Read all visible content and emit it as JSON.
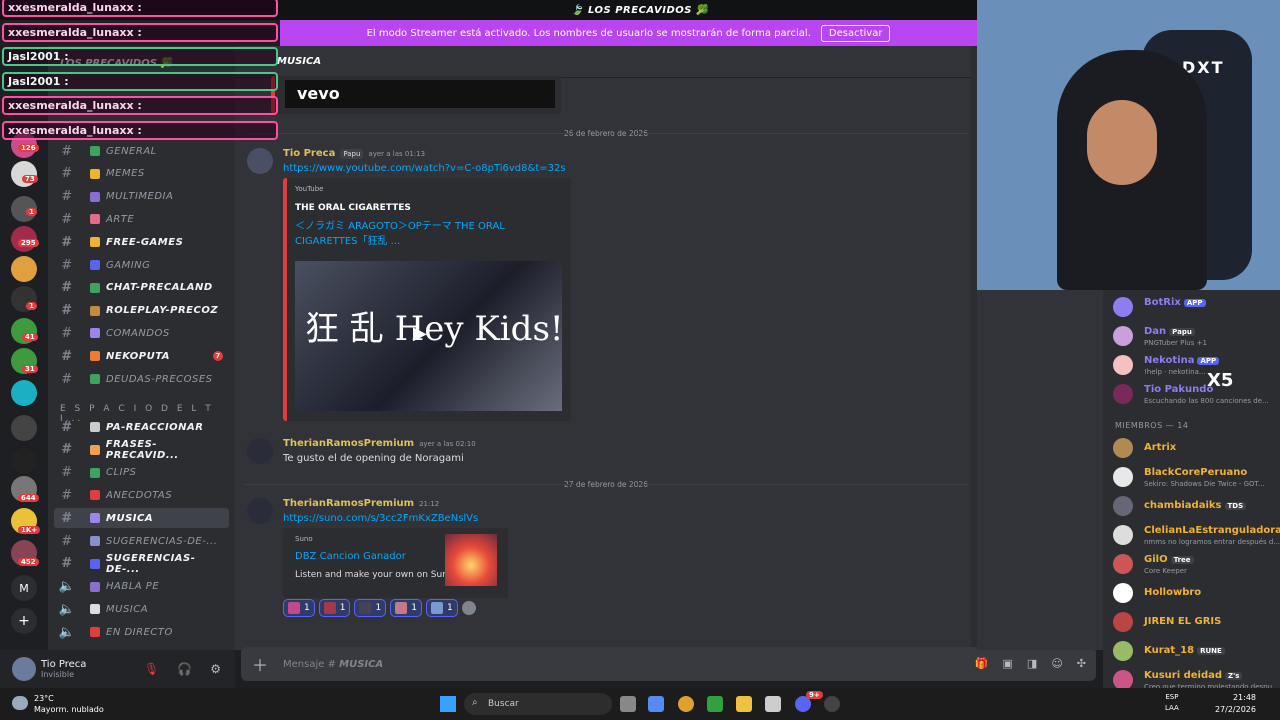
{
  "server": {
    "title": "🍃 LOS PRECAVIDOS 🥦",
    "name": "LOS PRECAVIDOS 🥦"
  },
  "streamer_banner": {
    "text": "El modo Streamer está activado. Los nombres de usuario se mostrarán de forma parcial.",
    "button": "Desactivar"
  },
  "chat_overlay": [
    {
      "user": "xxesmeralda_lunaxx :",
      "style": "pink"
    },
    {
      "user": "xxesmeralda_lunaxx :",
      "style": "pink"
    },
    {
      "user": "Jasl2001 :",
      "style": "green"
    },
    {
      "user": "Jasl2001 :",
      "style": "green"
    },
    {
      "user": "xxesmeralda_lunaxx :",
      "style": "pink"
    },
    {
      "user": "xxesmeralda_lunaxx :",
      "style": "pink"
    }
  ],
  "rail_badges": [
    "126",
    "73",
    "1",
    "295",
    "1",
    "41",
    "31",
    "644",
    "1K+",
    "452"
  ],
  "rail_letter": "M",
  "channels": [
    {
      "label": "GENERAL",
      "icon_color": "#3ba55d",
      "bold": false
    },
    {
      "label": "MEMES",
      "icon_color": "#f0b232",
      "bold": false
    },
    {
      "label": "MULTIMEDIA",
      "icon_color": "#8a6fd1",
      "bold": false
    },
    {
      "label": "ARTE",
      "icon_color": "#e86a8a",
      "bold": false
    },
    {
      "label": "FREE-GAMES",
      "icon_color": "#f0b232",
      "bold": true
    },
    {
      "label": "GAMING",
      "icon_color": "#5865f2",
      "bold": false
    },
    {
      "label": "CHAT-PRECALAND",
      "icon_color": "#3ba55d",
      "bold": true
    },
    {
      "label": "ROLEPLAY-PRECOZ",
      "icon_color": "#c58b3d",
      "bold": true
    },
    {
      "label": "COMANDOS",
      "icon_color": "#9b84ee",
      "bold": false
    },
    {
      "label": "NEKOPUTA",
      "icon_color": "#f07b32",
      "bold": true,
      "badge": "7"
    },
    {
      "label": "DEUDAS-PRECOSES",
      "icon_color": "#3ba55d",
      "bold": false
    }
  ],
  "category": "E S P A C I O D E L T I...",
  "channels2": [
    {
      "label": "PA-REACCIONAR",
      "icon_color": "#cccccc",
      "bold": true,
      "type": "text"
    },
    {
      "label": "FRASES-PRECAVID...",
      "icon_color": "#f0a050",
      "bold": true,
      "type": "text"
    },
    {
      "label": "CLIPS",
      "icon_color": "#3ba55d",
      "bold": false,
      "type": "text"
    },
    {
      "label": "ANECDOTAS",
      "icon_color": "#e23c3c",
      "bold": false,
      "type": "text"
    },
    {
      "label": "MUSICA",
      "icon_color": "#9b84ee",
      "bold": true,
      "type": "text",
      "active": true
    },
    {
      "label": "SUGERENCIAS-DE-...",
      "icon_color": "#8a8fd1",
      "bold": false,
      "type": "text"
    },
    {
      "label": "SUGERENCIAS-DE-...",
      "icon_color": "#5865f2",
      "bold": true,
      "type": "text"
    },
    {
      "label": "HABLA PE",
      "icon_color": "#8a6fd1",
      "bold": false,
      "type": "voice"
    },
    {
      "label": "MUSICA",
      "icon_color": "#dddddd",
      "bold": false,
      "type": "voice"
    },
    {
      "label": "EN DIRECTO",
      "icon_color": "#e23c3c",
      "bold": false,
      "type": "voice"
    }
  ],
  "user_panel": {
    "name": "Tio Preca",
    "status": "Invisible"
  },
  "channel_header": {
    "name": "MUSICA"
  },
  "messages": {
    "date1": "26 de febrero de 2026",
    "date2": "27 de febrero de 2026",
    "top_embed_text": "vevo",
    "m1": {
      "author": "Tio Preca",
      "tag": "Papu",
      "time": "ayer a las 01:13",
      "link": "https://www.youtube.com/watch?v=C-o8pTi6vd8&t=32s",
      "embed_provider": "YouTube",
      "embed_author": "THE ORAL CIGARETTES",
      "embed_title": "＜ノラガミ ARAGOTO＞OPテーマ THE ORAL CIGARETTES「狂乱 ...",
      "thumb_text": "狂 乱 Hey Kids!!"
    },
    "m2": {
      "author": "TherianRamosPremium",
      "time": "ayer a las 02:10",
      "text": "Te gusto el de opening de Noragami"
    },
    "m3": {
      "author": "TherianRamosPremium",
      "time": "21:12",
      "link": "https://suno.com/s/3cc2FmKxZBeNslVs",
      "embed_provider": "Suno",
      "embed_title": "DBZ Cancion Ganador",
      "embed_desc": "Listen and make your own on Suno."
    },
    "reactions": [
      "1",
      "1",
      "1",
      "1",
      "1"
    ]
  },
  "composer": {
    "placeholder_prefix": "Mensaje #",
    "channel": "MUSICA"
  },
  "members_top": [
    {
      "name": "BotRix",
      "color": "#8c7df0",
      "app": "APP",
      "sub": ""
    },
    {
      "name": "Dan",
      "color": "#8c7df0",
      "tag": "Papu",
      "sub": "PNGTuber Plus +1"
    },
    {
      "name": "Nekotina",
      "color": "#8c7df0",
      "app": "APP",
      "sub": "!help · nekotina..."
    },
    {
      "name": "Tio Pakundo",
      "color": "#8c7df0",
      "sub": "Escuchando las 800 canciones de..."
    }
  ],
  "members_header": "MIEMBROS — 14",
  "members": [
    {
      "name": "Artrix",
      "color": "#f0b232",
      "sub": ""
    },
    {
      "name": "BlackCorePeruano",
      "color": "#f0b232",
      "sub": "Sekiro: Shadows Die Twice - GOT..."
    },
    {
      "name": "chambiadaiks",
      "color": "#f0b232",
      "tag": "TDS",
      "sub": ""
    },
    {
      "name": "ClelianLaEstranguladora",
      "color": "#f0b232",
      "sub": "nmms no logramos entrar después d..."
    },
    {
      "name": "GilO",
      "color": "#f0b232",
      "tag": "Tree",
      "sub": "Core Keeper"
    },
    {
      "name": "Hollowbro",
      "color": "#f0b232",
      "sub": ""
    },
    {
      "name": "JIREN EL GRIS",
      "color": "#f0b232",
      "sub": ""
    },
    {
      "name": "Kurat_18",
      "color": "#f0b232",
      "tag": "RUNE",
      "sub": ""
    },
    {
      "name": "Kusuri deidad",
      "color": "#f0b232",
      "tag": "Z's",
      "sub": "Creo que termino molestando despu..."
    }
  ],
  "cam_text": "DXT",
  "x5": "X5",
  "taskbar": {
    "temp": "23°C",
    "weather": "Mayorm. nublado",
    "search": "Buscar",
    "lang1": "ESP",
    "lang2": "LAA",
    "time": "21:48",
    "date": "27/2/2026",
    "chrome_badge": "9+"
  }
}
